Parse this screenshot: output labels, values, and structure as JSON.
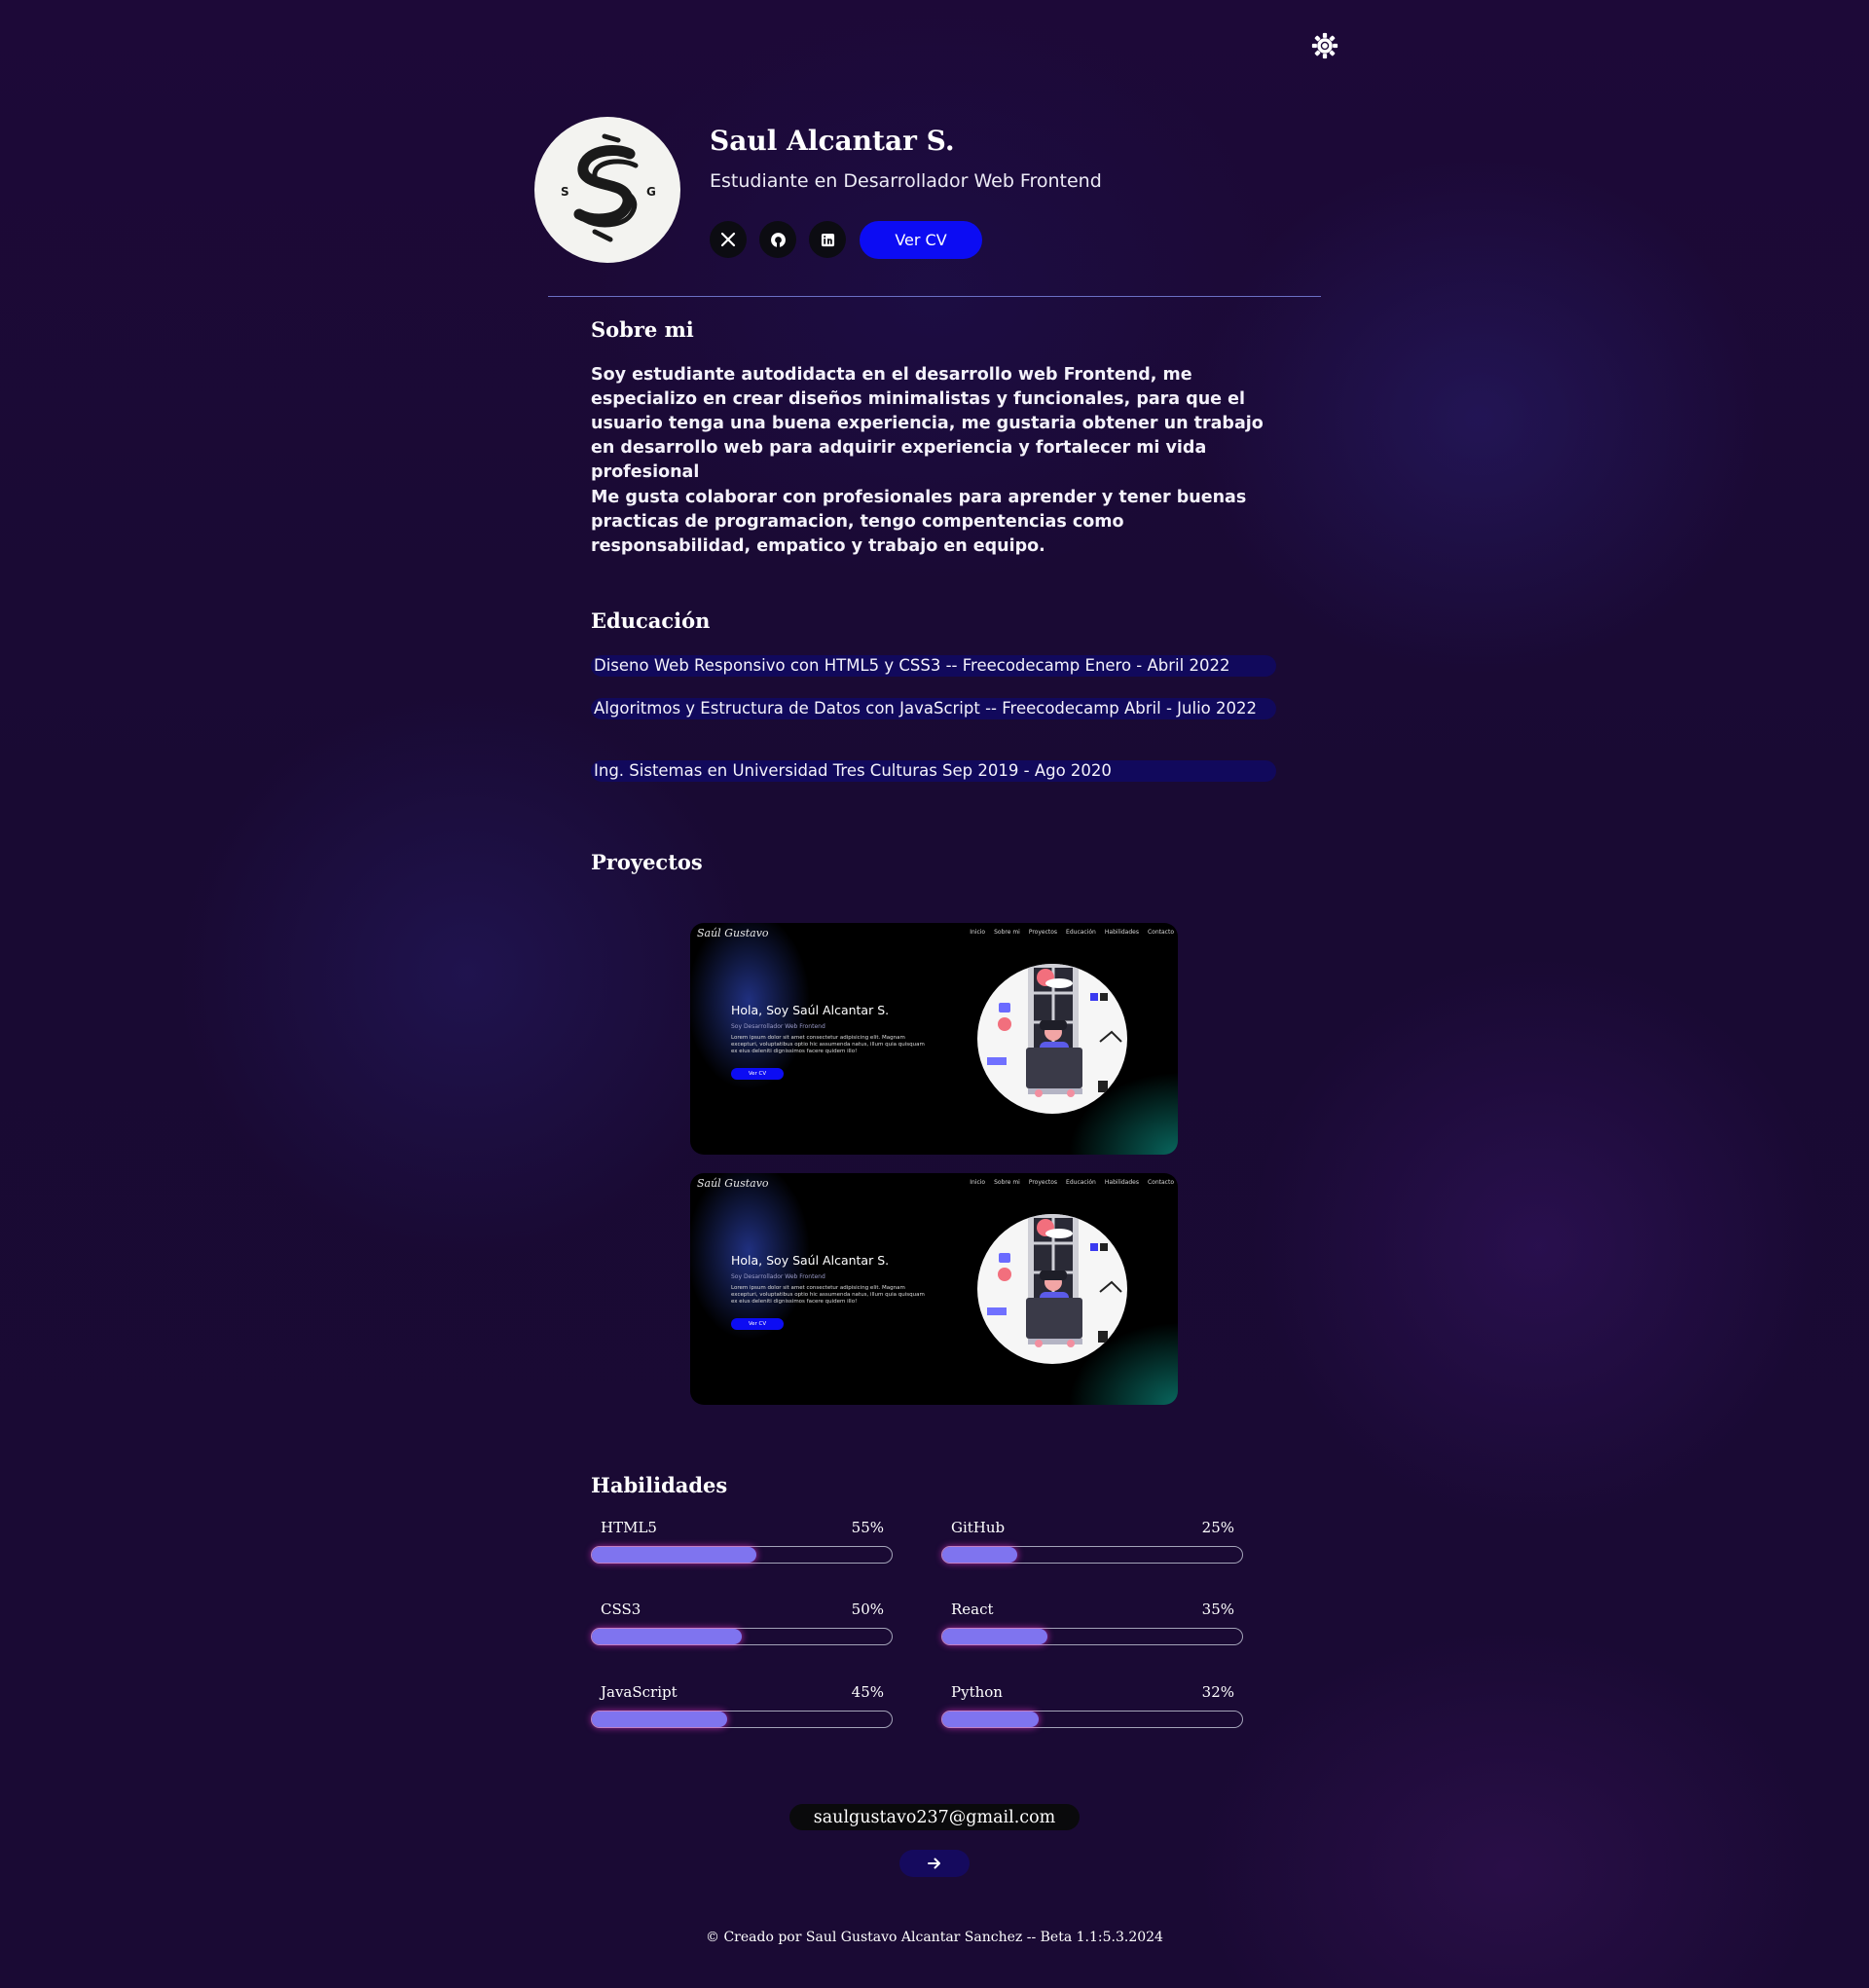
{
  "header": {
    "name": "Saul Alcantar S.",
    "role": "Estudiante en Desarrollador Web Frontend",
    "logo_letters": [
      "S",
      "G"
    ],
    "cv_label": "Ver CV",
    "theme_icon": "gear-icon",
    "social": [
      {
        "icon": "x-icon",
        "label": "X"
      },
      {
        "icon": "github-icon",
        "label": "GitHub"
      },
      {
        "icon": "linkedin-icon",
        "label": "LinkedIn"
      }
    ]
  },
  "about": {
    "title": "Sobre mi",
    "paragraph1": "Soy estudiante autodidacta en el desarrollo web Frontend, me especializo en crear diseños minimalistas y funcionales, para que el usuario tenga una buena experiencia, me gustaria obtener un trabajo en desarrollo web para adquirir experiencia y fortalecer mi vida profesional",
    "paragraph2": "Me gusta colaborar con profesionales para aprender y tener buenas practicas de programacion, tengo compentencias como responsabilidad, empatico y trabajo en equipo."
  },
  "education": {
    "title": "Educación",
    "items": [
      "Diseno Web Responsivo con HTML5 y CSS3 -- Freecodecamp Enero - Abril 2022",
      "Algoritmos y Estructura de Datos con JavaScript -- Freecodecamp Abril - Julio 2022",
      "Ing. Sistemas en Universidad Tres Culturas Sep 2019 - Ago 2020"
    ]
  },
  "projects": {
    "title": "Proyectos",
    "preview": {
      "logo": "Saúl Gustavo",
      "nav": [
        "Inicio",
        "Sobre mi",
        "Proyectos",
        "Educación",
        "Habilidades",
        "Contacto"
      ],
      "heading": "Hola, Soy Saúl Alcantar S.",
      "subheading": "Soy Desarrollador Web Frontend",
      "lorem": "Lorem ipsum dolor sit amet consectetur adipisicing elit. Magnam excepturi, voluptatibus optio hic assumenda natus, illum quia quisquam ex eius deleniti dignissimos facere quidem illo!",
      "button": "Ver CV"
    }
  },
  "skills": {
    "title": "Habilidades",
    "left": [
      {
        "name": "HTML5",
        "pct_label": "55%",
        "value": 55
      },
      {
        "name": "CSS3",
        "pct_label": "50%",
        "value": 50
      },
      {
        "name": "JavaScript",
        "pct_label": "45%",
        "value": 45
      }
    ],
    "right": [
      {
        "name": "GitHub",
        "pct_label": "25%",
        "value": 25
      },
      {
        "name": "React",
        "pct_label": "35%",
        "value": 35
      },
      {
        "name": "Python",
        "pct_label": "32%",
        "value": 32
      }
    ]
  },
  "contact": {
    "email": "saulgustavo237@gmail.com",
    "arrow_icon": "arrow-right-icon"
  },
  "footer": {
    "text": "© Creado por Saul Gustavo Alcantar Sanchez -- Beta 1.1:5.3.2024"
  },
  "colors": {
    "accent": "#0c0cf3",
    "skill_fill": "#7f74ef",
    "education_bg": "#11095c"
  }
}
